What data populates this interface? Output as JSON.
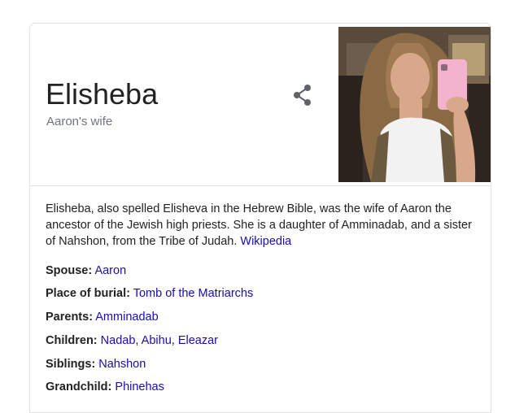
{
  "entity": {
    "name": "Elisheba",
    "subtitle": "Aaron's wife"
  },
  "description": {
    "text": "Elisheba, also spelled Elisheva in the Hebrew Bible, was the wife of Aaron the ancestor of the Jewish high priests. She is a daughter of Amminadab, and a sister of Nahshon, from the Tribe of Judah.",
    "source": "Wikipedia"
  },
  "facts": {
    "spouse": {
      "label": "Spouse:",
      "values": [
        "Aaron"
      ]
    },
    "burial": {
      "label": "Place of burial:",
      "values": [
        "Tomb of the Matriarchs"
      ]
    },
    "parents": {
      "label": "Parents:",
      "values": [
        "Amminadab"
      ]
    },
    "children": {
      "label": "Children:",
      "values": [
        "Nadab",
        "Abihu",
        "Eleazar"
      ]
    },
    "siblings": {
      "label": "Siblings:",
      "values": [
        "Nahshon"
      ]
    },
    "grandchild": {
      "label": "Grandchild:",
      "values": [
        "Phinehas"
      ]
    }
  },
  "icons": {
    "share": "share-icon"
  },
  "colors": {
    "link": "#1a0dab",
    "subtitle": "#70757a",
    "border": "#dfe1e5"
  }
}
